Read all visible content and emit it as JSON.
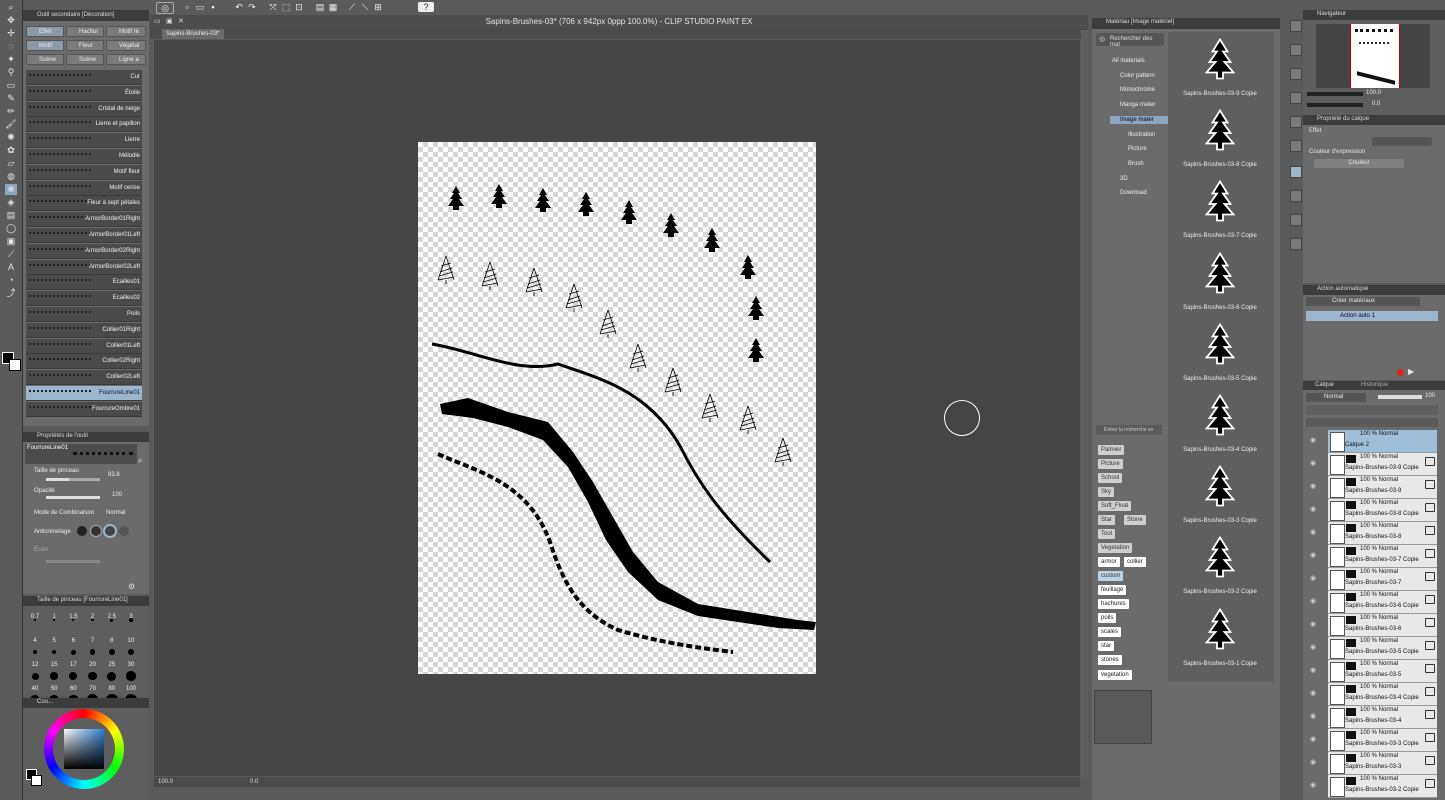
{
  "app": {
    "title": "Sapins-Brushes-03* (706 x 942px 0ppp 100.0%)  - CLIP STUDIO PAINT EX",
    "document_tab": "Sapins-Brushes-03*"
  },
  "subtool": {
    "header": "Outil secondaire [Décoration]",
    "tabs": [
      "Effet",
      "Hachur",
      "Motif ré",
      "Motif",
      "Fleur",
      "Végétal",
      "Scène",
      "Scène",
      "Ligne a"
    ],
    "brushes": [
      "Cur",
      "Étoile",
      "Cristal de neige",
      "Lierre et papillon",
      "Lierre",
      "Mélodie",
      "Motif fleur",
      "Motif cerise",
      "Fleur à sept pétales",
      "ArmorBorder01Right",
      "ArmorBorder01Left",
      "ArmorBorder02Right",
      "ArmorBorder02Left",
      "Ecailles01",
      "Ecailles02",
      "Poils",
      "Collier01Right",
      "Collier01Left",
      "Collier02Right",
      "Collier02Left",
      "FourrureLine01",
      "FourrureOmbre01"
    ],
    "selected_brush": "FourrureLine01"
  },
  "toolprops": {
    "header": "Propriétés de l'outil",
    "preset": "FourrureLine01",
    "brush_size_label": "Taille de pinceau",
    "brush_size_value": "83.8",
    "brush_size_fraction": 0.42,
    "opacity_label": "Opacité",
    "opacity_value": "100",
    "opacity_fraction": 1.0,
    "blend_label": "Mode de Combinaison",
    "blend_value": "Normal",
    "aa_label": "Anticrénelage",
    "spacing_label": "Écart"
  },
  "brushsize": {
    "header": "Taille de pinceau [FourrureLine01]",
    "values": [
      "0.7",
      "1",
      "1.5",
      "2",
      "2.5",
      "3",
      "4",
      "5",
      "6",
      "7",
      "8",
      "10",
      "12",
      "15",
      "17",
      "20",
      "25",
      "30",
      "40",
      "50",
      "60",
      "70",
      "80",
      "100"
    ]
  },
  "colorpanel": {
    "header": "Cou..."
  },
  "status": {
    "zoom": "100.0",
    "angle": "0.0"
  },
  "materials": {
    "header": "Matériau [Image matériel]",
    "search_placeholder": "Rechercher des mat",
    "tree": [
      "All materials",
      "Color pattern",
      "Monochrome",
      "Manga mater",
      "Image mater",
      "Illustration",
      "Picture",
      "Brush",
      "3D",
      "Download"
    ],
    "selected_tree": "Image mater",
    "search_tags_placeholder": "Entrer la recherche ex",
    "tags": [
      "Palmier",
      "Picture",
      "School",
      "Sky",
      "Soft_Float",
      "Star",
      "Stone",
      "Tool",
      "Vegetation",
      "armor",
      "collier",
      "custom",
      "feuillage",
      "hachures",
      "poils",
      "scales",
      "star",
      "stones",
      "vegetation"
    ],
    "items": [
      "Sapins-Brushes-03-9 Copie",
      "Sapins-Brushes-03-8 Copie",
      "Sapins-Brushes-03-7 Copie",
      "Sapins-Brushes-03-6 Copie",
      "Sapins-Brushes-03-5 Copie",
      "Sapins-Brushes-03-4 Copie",
      "Sapins-Brushes-03-3 Copie",
      "Sapins-Brushes-03-2 Copie",
      "Sapins-Brushes-03-1 Copie"
    ]
  },
  "navigator": {
    "header": "Navigateur",
    "zoom": "100.0",
    "angle": "0.0"
  },
  "layerprop": {
    "header": "Propriété du calque",
    "effect_label": "Effet",
    "expression_label": "Couleur d'expression",
    "expression_value": "Couleur"
  },
  "autoaction": {
    "header": "Action automatique",
    "set": "Créer matériaux",
    "action": "Action auto 1"
  },
  "layers": {
    "tab1": "Calque",
    "tab2": "Historique",
    "blend": "Normal",
    "opacity": "100",
    "rows": [
      {
        "mode": "100 % Normal",
        "name": "Calque 2",
        "selected": true
      },
      {
        "mode": "100 % Normal",
        "name": "Sapins-Brushes-03-9 Copie"
      },
      {
        "mode": "100 % Normal",
        "name": "Sapins-Brushes-03-9"
      },
      {
        "mode": "100 % Normal",
        "name": "Sapins-Brushes-03-8 Copie"
      },
      {
        "mode": "100 % Normal",
        "name": "Sapins-Brushes-03-8"
      },
      {
        "mode": "100 % Normal",
        "name": "Sapins-Brushes-03-7 Copie"
      },
      {
        "mode": "100 % Normal",
        "name": "Sapins-Brushes-03-7"
      },
      {
        "mode": "100 % Normal",
        "name": "Sapins-Brushes-03-6 Copie"
      },
      {
        "mode": "100 % Normal",
        "name": "Sapins-Brushes-03-6"
      },
      {
        "mode": "100 % Normal",
        "name": "Sapins-Brushes-03-5 Copie"
      },
      {
        "mode": "100 % Normal",
        "name": "Sapins-Brushes-03-5"
      },
      {
        "mode": "100 % Normal",
        "name": "Sapins-Brushes-03-4 Copie"
      },
      {
        "mode": "100 % Normal",
        "name": "Sapins-Brushes-03-4"
      },
      {
        "mode": "100 % Normal",
        "name": "Sapins-Brushes-03-3 Copie"
      },
      {
        "mode": "100 % Normal",
        "name": "Sapins-Brushes-03-3"
      },
      {
        "mode": "100 % Normal",
        "name": "Sapins-Brushes-03-2 Copie"
      }
    ]
  },
  "colors": {
    "accent": "#9bb5cc",
    "panel": "#6b6b6b",
    "canvas_bg": "#454545"
  }
}
